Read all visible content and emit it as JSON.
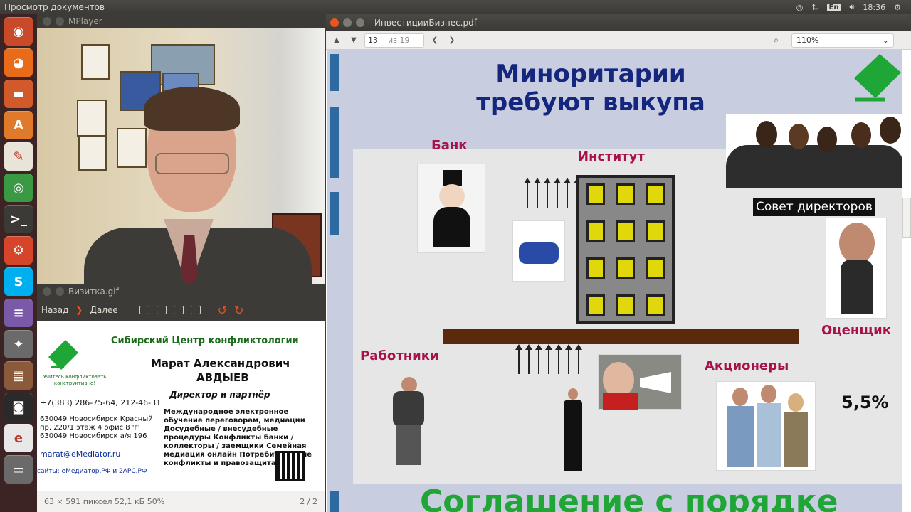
{
  "topbar": {
    "app_title": "Просмотр документов",
    "time": "18:36",
    "keyboard_layout": "En"
  },
  "launcher": {
    "items": [
      {
        "name": "ubuntu-icon",
        "glyph": "◉",
        "color": "#c84a2a"
      },
      {
        "name": "firefox-icon",
        "glyph": "◕",
        "color": "#e86b1a"
      },
      {
        "name": "files-icon",
        "glyph": "▬",
        "color": "#d25a2a"
      },
      {
        "name": "software-center-icon",
        "glyph": "A",
        "color": "#e07a2a"
      },
      {
        "name": "text-editor-icon",
        "glyph": "✎",
        "color": "#e8e4d8"
      },
      {
        "name": "chrome-icon",
        "glyph": "◎",
        "color": "#3a9a44"
      },
      {
        "name": "terminal-icon",
        "glyph": ">_",
        "color": "#3b3a36"
      },
      {
        "name": "settings-icon",
        "glyph": "⚙",
        "color": "#d6452a"
      },
      {
        "name": "skype-icon",
        "glyph": "S",
        "color": "#00aff0"
      },
      {
        "name": "database-icon",
        "glyph": "≡",
        "color": "#7a5aa8"
      },
      {
        "name": "gimp-icon",
        "glyph": "✦",
        "color": "#6a6a6a"
      },
      {
        "name": "books-icon",
        "glyph": "▤",
        "color": "#8a5a3a"
      },
      {
        "name": "camera-icon",
        "glyph": "◙",
        "color": "#2a2a2a"
      },
      {
        "name": "evince-icon",
        "glyph": "e",
        "color": "#e8e8e8"
      },
      {
        "name": "trash-icon",
        "glyph": "▭",
        "color": "#6a6a6a"
      }
    ]
  },
  "mplayer": {
    "title": "MPlayer"
  },
  "viewer": {
    "title": "Визитка.gif",
    "back": "Назад",
    "forward": "Далее",
    "status": "63 × 591 пиксел  52,1 кБ  50%",
    "page": "2 / 2",
    "card": {
      "org": "Сибирский Центр конфликтологии",
      "name1": "Марат Александрович",
      "name2": "АВДЫЕВ",
      "role": "Директор и партнёр",
      "phone": "+7(383) 286-75-64, 212-46-31",
      "address1": "630049 Новосибирск Красный пр. 220/1 этаж 4 офис 8 'г'",
      "address2": "630049 Новосибирск а/я 196",
      "services": "Международное электронное обучение переговорам, медиации Досудебные / внесудебные процедуры Конфликты банки / коллекторы / заемщики Семейная медиация онлайн Потребительские конфликты и правозащита.",
      "email": "marat@eMediator.ru",
      "sites": "сайты: еМедиатор.РФ и 2АРС.РФ",
      "slogan": "Учитесь конфликтовать конструктивно!"
    }
  },
  "pdf": {
    "title": "ИнвестицииБизнес.pdf",
    "page_current": "13",
    "page_of": "из 19",
    "zoom": "110%",
    "slide": {
      "title_line1": "Миноритарии",
      "title_line2": "требуют выкупа",
      "bank": "Банк",
      "institute": "Институт",
      "board": "Совет директоров",
      "appraiser": "Оценщик",
      "workers": "Работники",
      "shareholders": "Акционеры",
      "percent": "5,5%",
      "bottom": "Соглашение с порядке"
    }
  },
  "colors": {
    "accent": "#14267e",
    "label": "#a8124a",
    "green": "#1fa636"
  }
}
